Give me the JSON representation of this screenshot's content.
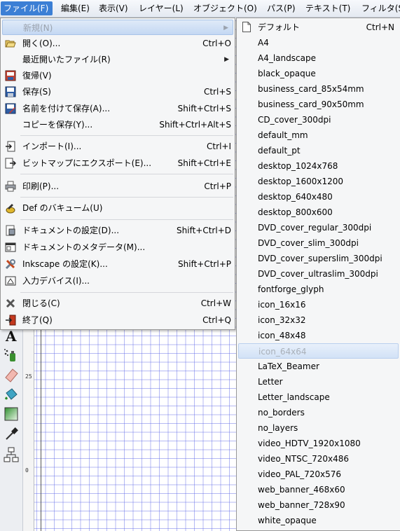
{
  "menubar": {
    "items": [
      {
        "label": "ファイル(F)",
        "active": true
      },
      {
        "label": "編集(E)"
      },
      {
        "label": "表示(V)"
      },
      {
        "label": "レイヤー(L)"
      },
      {
        "label": "オブジェクト(O)"
      },
      {
        "label": "パス(P)"
      },
      {
        "label": "テキスト(T)"
      },
      {
        "label": "フィルタ(S"
      }
    ]
  },
  "file_menu": {
    "items": [
      {
        "label": "新規(N)",
        "accel": "",
        "submenu": true,
        "icon": "none",
        "selected": true
      },
      {
        "label": "開く(O)...",
        "accel": "Ctrl+O",
        "icon": "folder-open-icon"
      },
      {
        "label": "最近開いたファイル(R)",
        "accel": "",
        "submenu": true,
        "icon": "none"
      },
      {
        "label": "復帰(V)",
        "accel": "",
        "icon": "revert-icon"
      },
      {
        "label": "保存(S)",
        "accel": "Ctrl+S",
        "icon": "save-icon"
      },
      {
        "label": "名前を付けて保存(A)...",
        "accel": "Shift+Ctrl+S",
        "icon": "save-as-icon"
      },
      {
        "label": "コピーを保存(Y)...",
        "accel": "Shift+Ctrl+Alt+S",
        "icon": "none"
      },
      {
        "label": "インポート(I)...",
        "accel": "Ctrl+I",
        "icon": "import-icon"
      },
      {
        "label": "ビットマップにエクスポート(E)...",
        "accel": "Shift+Ctrl+E",
        "icon": "export-bitmap-icon"
      },
      {
        "label": "印刷(P)...",
        "accel": "Ctrl+P",
        "icon": "print-icon"
      },
      {
        "label": "Def のバキューム(U)",
        "accel": "",
        "icon": "vacuum-defs-icon"
      },
      {
        "label": "ドキュメントの設定(D)...",
        "accel": "Shift+Ctrl+D",
        "icon": "document-properties-icon"
      },
      {
        "label": "ドキュメントのメタデータ(M)...",
        "accel": "",
        "icon": "document-metadata-icon"
      },
      {
        "label": "Inkscape の設定(K)...",
        "accel": "Shift+Ctrl+P",
        "icon": "preferences-icon"
      },
      {
        "label": "入力デバイス(I)...",
        "accel": "",
        "icon": "input-devices-icon"
      },
      {
        "label": "閉じる(C)",
        "accel": "Ctrl+W",
        "icon": "close-icon"
      },
      {
        "label": "終了(Q)",
        "accel": "Ctrl+Q",
        "icon": "quit-icon"
      }
    ]
  },
  "new_submenu": {
    "items": [
      {
        "label": "デフォルト",
        "accel": "Ctrl+N"
      },
      {
        "label": "A4"
      },
      {
        "label": "A4_landscape"
      },
      {
        "label": "black_opaque"
      },
      {
        "label": "business_card_85x54mm"
      },
      {
        "label": "business_card_90x50mm"
      },
      {
        "label": "CD_cover_300dpi"
      },
      {
        "label": "default_mm"
      },
      {
        "label": "default_pt"
      },
      {
        "label": "desktop_1024x768"
      },
      {
        "label": "desktop_1600x1200"
      },
      {
        "label": "desktop_640x480"
      },
      {
        "label": "desktop_800x600"
      },
      {
        "label": "DVD_cover_regular_300dpi"
      },
      {
        "label": "DVD_cover_slim_300dpi"
      },
      {
        "label": "DVD_cover_superslim_300dpi"
      },
      {
        "label": "DVD_cover_ultraslim_300dpi"
      },
      {
        "label": "fontforge_glyph"
      },
      {
        "label": "icon_16x16"
      },
      {
        "label": "icon_32x32"
      },
      {
        "label": "icon_48x48"
      },
      {
        "label": "icon_64x64",
        "selected": true
      },
      {
        "label": "LaTeX_Beamer"
      },
      {
        "label": "Letter"
      },
      {
        "label": "Letter_landscape"
      },
      {
        "label": "no_borders"
      },
      {
        "label": "no_layers"
      },
      {
        "label": "video_HDTV_1920x1080"
      },
      {
        "label": "video_NTSC_720x486"
      },
      {
        "label": "video_PAL_720x576"
      },
      {
        "label": "web_banner_468x60"
      },
      {
        "label": "web_banner_728x90"
      },
      {
        "label": "white_opaque"
      }
    ]
  },
  "ruler": {
    "labels": [
      "25",
      "0"
    ]
  },
  "toolbox": {
    "tools": [
      "text-tool-icon",
      "spray-tool-icon",
      "eraser-tool-icon",
      "paint-bucket-icon",
      "gradient-tool-icon",
      "dropper-icon",
      "connector-tool-icon"
    ]
  }
}
